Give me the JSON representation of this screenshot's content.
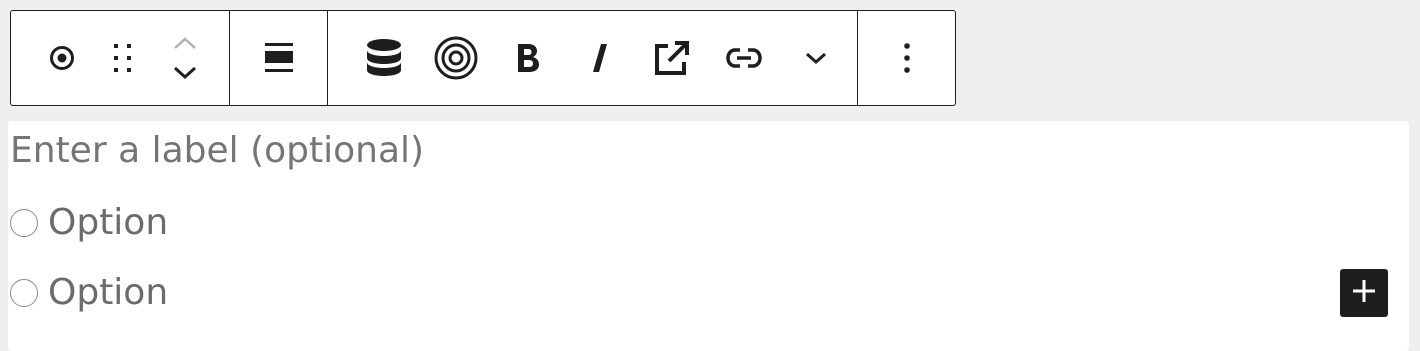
{
  "toolbar": {
    "groups": [
      {
        "items": [
          "block-type-icon",
          "drag-handle-icon",
          "move-up-icon",
          "move-down-icon"
        ]
      },
      {
        "items": [
          "align-icon"
        ]
      },
      {
        "items": [
          "database-icon",
          "target-icon",
          "bold-icon",
          "italic-icon",
          "external-link-icon",
          "link-icon",
          "chevron-down-icon"
        ]
      },
      {
        "items": [
          "more-options-icon"
        ]
      }
    ]
  },
  "form": {
    "label_placeholder": "Enter a label (optional)",
    "options": [
      {
        "label": "Option"
      },
      {
        "label": "Option"
      }
    ]
  },
  "add_block_icon": "plus-icon",
  "colors": {
    "background": "#efefef",
    "toolbar_border": "#1e1e1e",
    "placeholder_text": "#757575",
    "add_button": "#1e1e1e"
  }
}
